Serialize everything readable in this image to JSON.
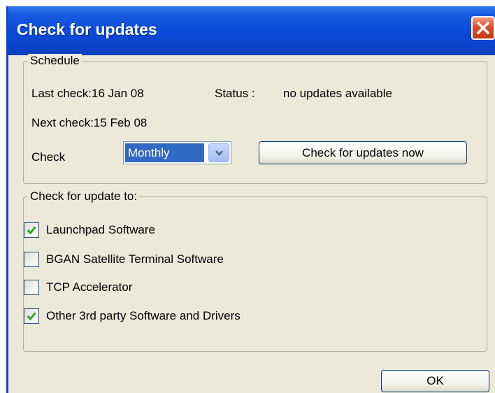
{
  "window": {
    "title": "Check for updates"
  },
  "schedule": {
    "legend": "Schedule",
    "last_check": "Last check:16 Jan 08",
    "status_label": "Status :",
    "status_value": "no updates available",
    "next_check": "Next check:15 Feb 08",
    "check_label": "Check",
    "frequency_selected": "Monthly",
    "check_now_label": "Check for updates now"
  },
  "update_targets": {
    "legend": "Check for update to:",
    "items": [
      {
        "label": "Launchpad Software",
        "checked": true
      },
      {
        "label": "BGAN Satellite Terminal Software",
        "checked": false
      },
      {
        "label": "TCP Accelerator",
        "checked": false
      },
      {
        "label": "Other 3rd party Software and Drivers",
        "checked": true
      }
    ]
  },
  "footer": {
    "ok_label": "OK"
  },
  "colors": {
    "titlebar": "#0a4ad8",
    "dialog_bg": "#ece9d8",
    "selection": "#316ac5",
    "close_button": "#d8502d",
    "checkmark": "#21a121"
  }
}
